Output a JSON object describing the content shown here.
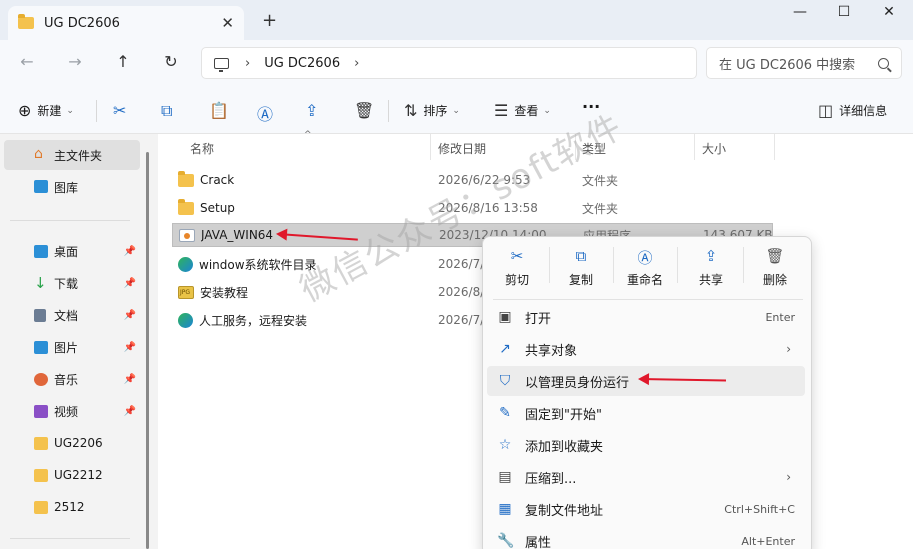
{
  "window": {
    "tab_title": "UG DC2606",
    "tab_close": "✕",
    "new_tab": "+",
    "minimize": "—",
    "maximize": "☐",
    "close": "✕"
  },
  "address": {
    "crumbs": [
      "UG DC2606"
    ],
    "search_placeholder": "在 UG DC2606 中搜索"
  },
  "toolbar": {
    "new_label": "新建",
    "sort_label": "排序",
    "view_label": "查看",
    "more_label": "···",
    "details_label": "详细信息"
  },
  "sidebar": {
    "home": "主文件夹",
    "gallery": "图库",
    "items": [
      {
        "label": "桌面",
        "icon": "desktop-icon",
        "color": "#2b8fd6"
      },
      {
        "label": "下载",
        "icon": "download-icon",
        "color": "#2aa24b"
      },
      {
        "label": "文档",
        "icon": "document-icon",
        "color": "#6b7c93"
      },
      {
        "label": "图片",
        "icon": "picture-icon",
        "color": "#2b8fd6"
      },
      {
        "label": "音乐",
        "icon": "music-icon",
        "color": "#e0663a"
      },
      {
        "label": "视频",
        "icon": "video-icon",
        "color": "#8a4fc6"
      }
    ],
    "folders": [
      "UG2206",
      "UG2212",
      "2512"
    ]
  },
  "columns": {
    "name": "名称",
    "modified": "修改日期",
    "type": "类型",
    "size": "大小"
  },
  "files": [
    {
      "name": "Crack",
      "date": "2026/6/22 9:53",
      "type": "文件夹",
      "size": "",
      "icon": "folder"
    },
    {
      "name": "Setup",
      "date": "2026/8/16 13:58",
      "type": "文件夹",
      "size": "",
      "icon": "folder"
    },
    {
      "name": "JAVA_WIN64",
      "date": "2023/12/10 14:00",
      "type": "应用程序",
      "size": "143,607 KB",
      "icon": "java"
    },
    {
      "name": "window系统软件目录",
      "date": "2026/7/",
      "type": "",
      "size": "",
      "icon": "edge"
    },
    {
      "name": "安装教程",
      "date": "2026/8/",
      "type": "",
      "size": "",
      "icon": "jpg"
    },
    {
      "name": "人工服务，远程安装",
      "date": "2026/7/",
      "type": "",
      "size": "",
      "icon": "edge"
    }
  ],
  "context_menu": {
    "quick_actions": [
      "剪切",
      "复制",
      "重命名",
      "共享",
      "删除"
    ],
    "items": [
      {
        "label": "打开",
        "shortcut": "Enter",
        "icon": "open-icon"
      },
      {
        "label": "共享对象",
        "shortcut": "",
        "icon": "share-icon",
        "submenu": true
      },
      {
        "label": "以管理员身份运行",
        "shortcut": "",
        "icon": "shield-icon"
      },
      {
        "label": "固定到\"开始\"",
        "shortcut": "",
        "icon": "pin-icon"
      },
      {
        "label": "添加到收藏夹",
        "shortcut": "",
        "icon": "star-icon"
      },
      {
        "label": "压缩到...",
        "shortcut": "",
        "icon": "zip-icon",
        "submenu": true
      },
      {
        "label": "复制文件地址",
        "shortcut": "Ctrl+Shift+C",
        "icon": "copy-path-icon"
      },
      {
        "label": "属性",
        "shortcut": "Alt+Enter",
        "icon": "properties-icon"
      }
    ]
  },
  "watermark": "微信公众号：soft软件",
  "accent": "#1f6bc4",
  "arrow_color": "#e0182b"
}
